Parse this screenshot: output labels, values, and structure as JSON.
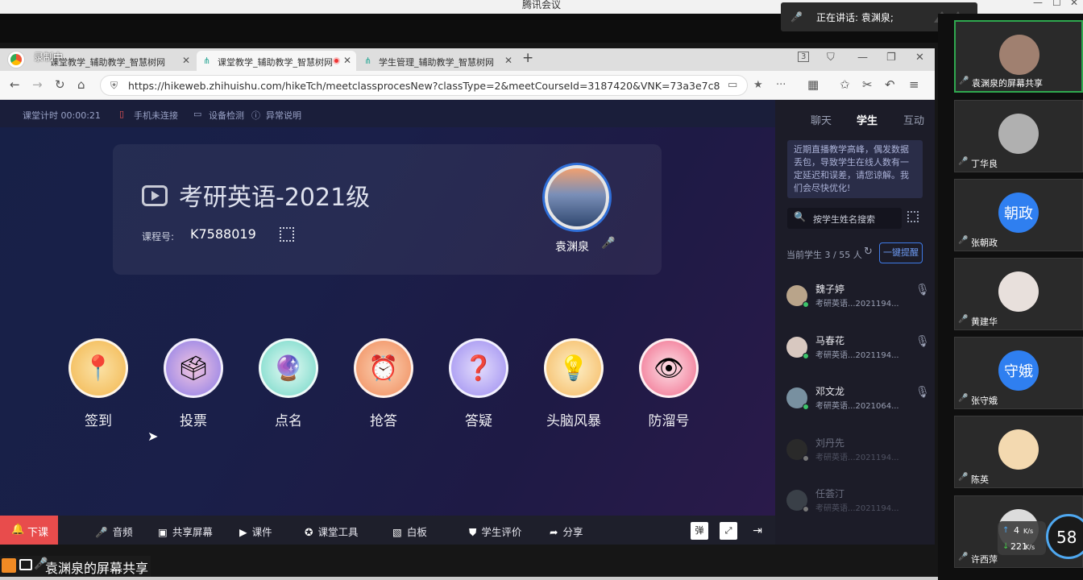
{
  "meeting": {
    "window_title": "腾讯会议",
    "speaking_text": "正在讲话: 袁渊泉;",
    "recording_text": "录制中",
    "share_label": "袁渊泉的屏幕共享"
  },
  "browser": {
    "tabs": [
      {
        "label": "课堂教学_辅助教学_智慧树网"
      },
      {
        "label": "课堂教学_辅助教学_智慧树网"
      },
      {
        "label": "学生管理_辅助教学_智慧树网"
      }
    ],
    "tab_count": "3",
    "url": "https://hikeweb.zhihuishu.com/hikeTch/meetclassprocesNew?classType=2&meetCourseId=3187420&VNK=73a3e7c8"
  },
  "app": {
    "status": {
      "timer": "课堂计时 00:00:21",
      "phone": "手机未连接",
      "device": "设备检测",
      "exception": "异常说明"
    },
    "course": {
      "title": "考研英语-2021级",
      "number_label": "课程号:",
      "number": "K7588019",
      "teacher": "袁渊泉"
    },
    "tools": [
      {
        "label": "签到",
        "icon": "location-pin-icon",
        "color": "#f2b64e"
      },
      {
        "label": "投票",
        "icon": "vote-box-icon",
        "color": "#8a7be8"
      },
      {
        "label": "点名",
        "icon": "lottery-ball-icon",
        "color": "#6fd6c6"
      },
      {
        "label": "抢答",
        "icon": "alarm-clock-icon",
        "color": "#f08a5a"
      },
      {
        "label": "答疑",
        "icon": "question-sign-icon",
        "color": "#9c8cf0"
      },
      {
        "label": "头脑风暴",
        "icon": "lightbulb-icon",
        "color": "#f5b860"
      },
      {
        "label": "防溜号",
        "icon": "eye-icon",
        "color": "#f06a8a"
      }
    ],
    "panel": {
      "tabs": [
        "聊天",
        "学生",
        "互动"
      ],
      "notice": "近期直播教学高峰，偶发数据丢包，导致学生在线人数有一定延迟和误差，请您谅解。我们会尽快优化!",
      "search_placeholder": "按学生姓名搜索",
      "count": "当前学生 3 / 55 人",
      "remind_button": "一键提醒",
      "students": [
        {
          "name": "魏子婷",
          "info": "考研英语...2021194...",
          "online": true
        },
        {
          "name": "马春花",
          "info": "考研英语...2021194...",
          "online": true
        },
        {
          "name": "邓文龙",
          "info": "考研英语...2021064...",
          "online": true
        },
        {
          "name": "刘丹先",
          "info": "考研英语...2021194...",
          "online": false
        },
        {
          "name": "任荟汀",
          "info": "考研英语...2021194...",
          "online": false
        }
      ]
    },
    "toolbar": {
      "end_class": "下课",
      "items": [
        "音频",
        "共享屏幕",
        "课件",
        "课堂工具",
        "白板",
        "学生评价",
        "分享"
      ],
      "danmu": "弹"
    }
  },
  "participants": [
    {
      "name": "袁渊泉的屏幕共享",
      "avatar": ""
    },
    {
      "name": "丁华良",
      "avatar": ""
    },
    {
      "name": "张朝政",
      "avatar": "朝政"
    },
    {
      "name": "黄建华",
      "avatar": ""
    },
    {
      "name": "张守娥",
      "avatar": "守娥"
    },
    {
      "name": "陈英",
      "avatar": ""
    },
    {
      "name": "许西萍",
      "avatar": ""
    }
  ],
  "network": {
    "up": "4",
    "down": "221",
    "unit": "K/s",
    "percent": "58"
  }
}
